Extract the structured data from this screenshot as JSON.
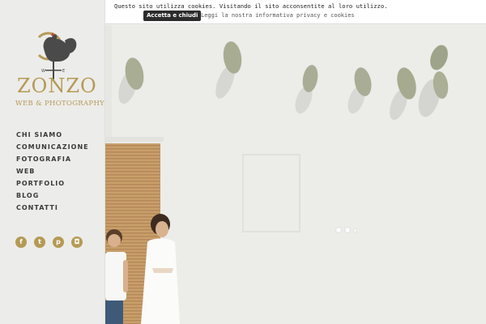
{
  "brand": {
    "logo_word": "ZONZO",
    "logo_sub": "WEB & PHOTOGRAPHY",
    "accent_color": "#b59a55"
  },
  "nav": {
    "items": [
      {
        "label": "CHI SIAMO"
      },
      {
        "label": "COMUNICAZIONE"
      },
      {
        "label": "FOTOGRAFIA"
      },
      {
        "label": "WEB"
      },
      {
        "label": "PORTFOLIO"
      },
      {
        "label": "BLOG"
      },
      {
        "label": "CONTATTI"
      }
    ]
  },
  "social": {
    "icons": [
      {
        "name": "facebook-icon",
        "glyph": "f"
      },
      {
        "name": "twitter-icon",
        "glyph": "t"
      },
      {
        "name": "pinterest-icon",
        "glyph": "p"
      },
      {
        "name": "instagram-icon",
        "glyph": "◘"
      }
    ]
  },
  "cookie": {
    "message": "Questo sito utilizza cookies. Visitando il sito acconsentite al loro utilizzo.",
    "accept_label": "Accetta e chiudi",
    "info_link": "Leggi la nostra informativa privacy e cookies"
  },
  "slider": {
    "dot_count": 3,
    "active_index": 0
  }
}
